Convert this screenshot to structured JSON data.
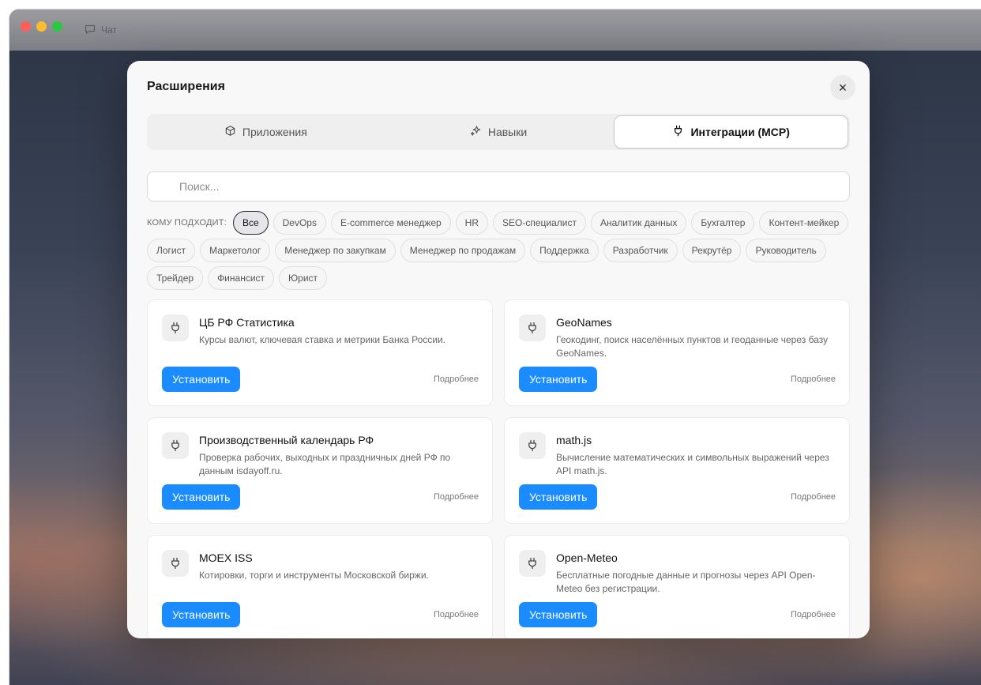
{
  "window": {
    "chat_tab_label": "Чат"
  },
  "modal": {
    "title": "Расширения",
    "close_label": "×"
  },
  "tabs": [
    {
      "label": "Приложения",
      "icon": "box-icon"
    },
    {
      "label": "Навыки",
      "icon": "sparkles-icon"
    },
    {
      "label": "Интеграции (MCP)",
      "icon": "plug-icon",
      "active": true
    }
  ],
  "search": {
    "placeholder": "Поиск...",
    "value": ""
  },
  "filters": {
    "label": "КОМУ ПОДХОДИТ:",
    "chips": [
      "Все",
      "DevOps",
      "E-commerce менеджер",
      "HR",
      "SEO-специалист",
      "Аналитик данных",
      "Бухгалтер",
      "Контент-мейкер",
      "Логист",
      "Маркетолог",
      "Менеджер по закупкам",
      "Менеджер по продажам",
      "Поддержка",
      "Разработчик",
      "Рекрутёр",
      "Руководитель",
      "Трейдер",
      "Финансист",
      "Юрист"
    ],
    "selected": "Все"
  },
  "cards": [
    {
      "title": "ЦБ РФ Статистика",
      "description": "Курсы валют, ключевая ставка и метрики Банка России.",
      "install": "Установить",
      "more": "Подробнее"
    },
    {
      "title": "GeoNames",
      "description": "Геокодинг, поиск населённых пунктов и геоданные через базу GeoNames.",
      "install": "Установить",
      "more": "Подробнее"
    },
    {
      "title": "Производственный календарь РФ",
      "description": "Проверка рабочих, выходных и праздничных дней РФ по данным isdayoff.ru.",
      "install": "Установить",
      "more": "Подробнее"
    },
    {
      "title": "math.js",
      "description": "Вычисление математических и символьных выражений через API math.js.",
      "install": "Установить",
      "more": "Подробнее"
    },
    {
      "title": "MOEX ISS",
      "description": "Котировки, торги и инструменты Московской биржи.",
      "install": "Установить",
      "more": "Подробнее"
    },
    {
      "title": "Open-Meteo",
      "description": "Бесплатные погодные данные и прогнозы через API Open-Meteo без регистрации.",
      "install": "Установить",
      "more": "Подробнее"
    }
  ],
  "colors": {
    "accent": "#1a8cff",
    "modal_bg": "#f8f8f8"
  }
}
